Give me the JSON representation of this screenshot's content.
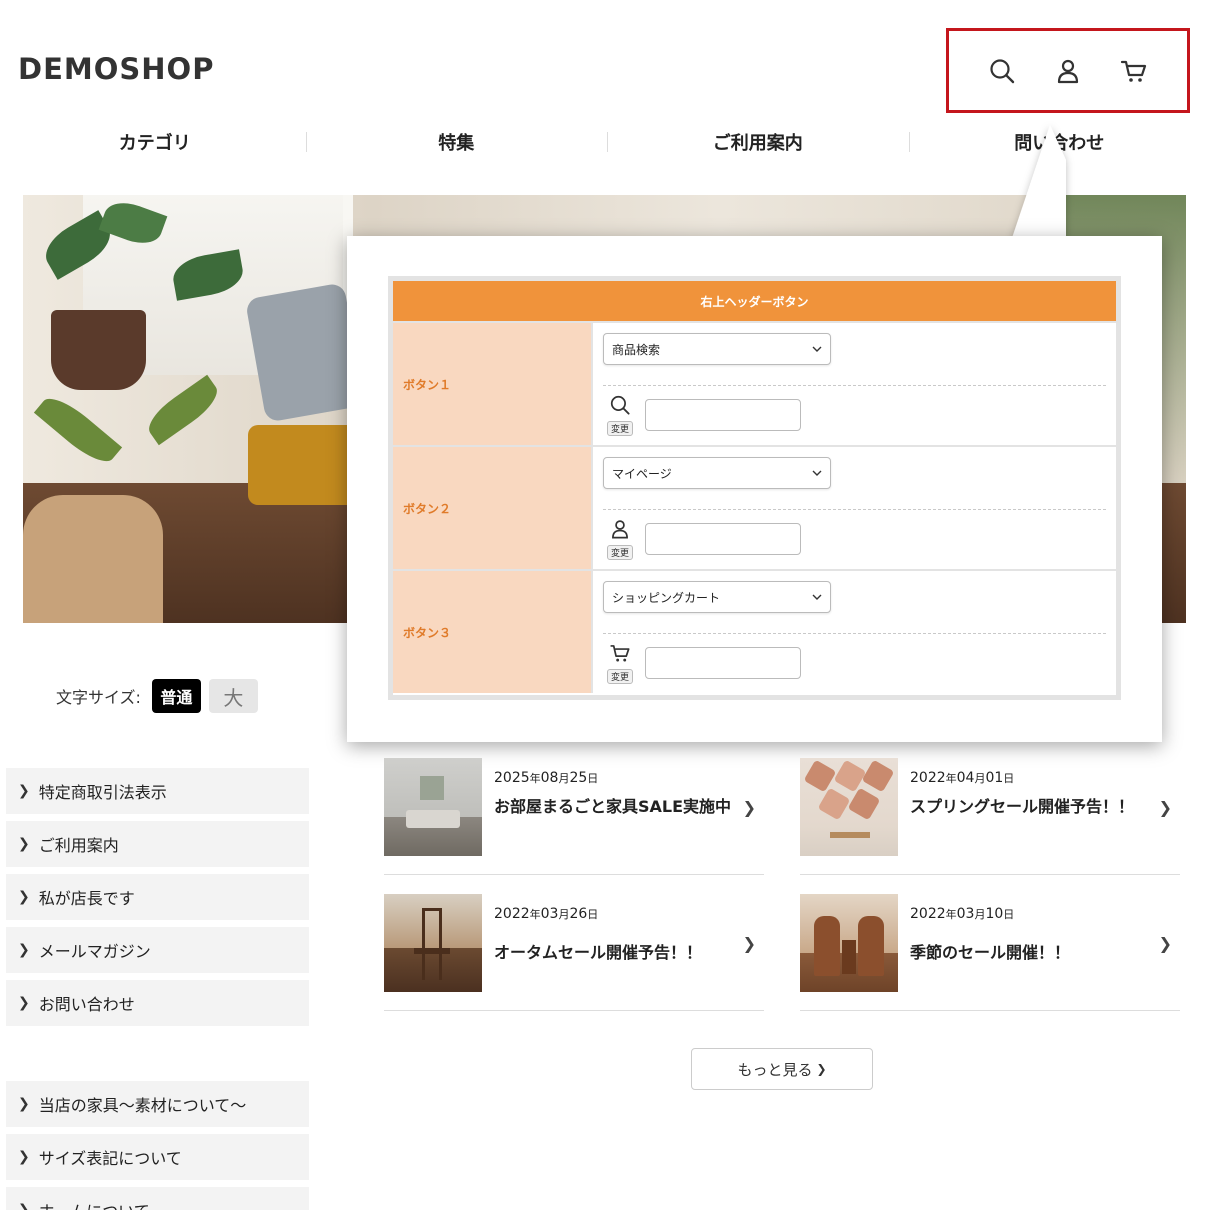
{
  "header": {
    "logo": "DEMOSHOP",
    "icons": [
      "search-icon",
      "user-icon",
      "cart-icon"
    ]
  },
  "global_nav": [
    {
      "label": "カテゴリ"
    },
    {
      "label": "特集"
    },
    {
      "label": "ご利用案内"
    },
    {
      "label": "問い合わせ"
    }
  ],
  "callout": {
    "title": "右上ヘッダーボタン",
    "rows": [
      {
        "label": "ボタン１",
        "select_value": "商品検索",
        "icon": "search-icon",
        "change_label": "変更",
        "input_value": ""
      },
      {
        "label": "ボタン２",
        "select_value": "マイページ",
        "icon": "user-icon",
        "change_label": "変更",
        "input_value": ""
      },
      {
        "label": "ボタン３",
        "select_value": "ショッピングカート",
        "icon": "cart-icon",
        "change_label": "変更",
        "input_value": ""
      }
    ]
  },
  "font_size": {
    "label": "文字サイズ:",
    "normal": "普通",
    "large": "大"
  },
  "sidebar_1": [
    {
      "label": "特定商取引法表示"
    },
    {
      "label": "ご利用案内"
    },
    {
      "label": "私が店長です"
    },
    {
      "label": "メールマガジン"
    },
    {
      "label": "お問い合わせ"
    }
  ],
  "sidebar_2": [
    {
      "label": "当店の家具〜素材について〜"
    },
    {
      "label": "サイズ表記について"
    },
    {
      "label": "ホームについて"
    }
  ],
  "news": [
    {
      "year": "2025",
      "month": "08",
      "day": "25",
      "y_unit": "年",
      "m_unit": "月",
      "d_unit": "日",
      "title": "お部屋まるごと家具SALE実施中"
    },
    {
      "year": "2022",
      "month": "04",
      "day": "01",
      "y_unit": "年",
      "m_unit": "月",
      "d_unit": "日",
      "title": "スプリングセール開催予告！！"
    },
    {
      "year": "2022",
      "month": "03",
      "day": "26",
      "y_unit": "年",
      "m_unit": "月",
      "d_unit": "日",
      "title": "オータムセール開催予告！！"
    },
    {
      "year": "2022",
      "month": "03",
      "day": "10",
      "y_unit": "年",
      "m_unit": "月",
      "d_unit": "日",
      "title": "季節のセール開催！！"
    }
  ],
  "more_button": "もっと見る",
  "colors": {
    "highlight_border": "#c4161c",
    "cfg_header": "#f0933b",
    "cfg_label_bg": "#f9d8c0",
    "cfg_label_text": "#e07b2a"
  }
}
